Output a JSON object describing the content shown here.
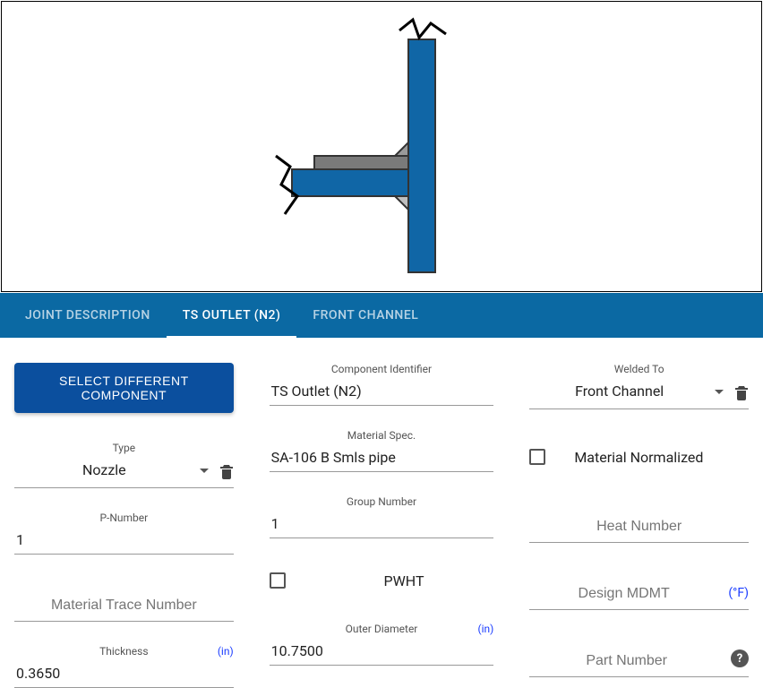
{
  "tabs": {
    "joint_description": "JOINT DESCRIPTION",
    "ts_outlet": "TS OUTLET (N2)",
    "front_channel": "FRONT CHANNEL"
  },
  "button": {
    "select_component": "SELECT DIFFERENT COMPONENT"
  },
  "fields": {
    "component_identifier": {
      "label": "Component Identifier",
      "value": "TS Outlet (N2)"
    },
    "welded_to": {
      "label": "Welded To",
      "value": "Front Channel"
    },
    "type": {
      "label": "Type",
      "value": "Nozzle"
    },
    "material_spec": {
      "label": "Material Spec.",
      "value": "SA-106 B Smls pipe"
    },
    "material_normalized": {
      "label": "Material Normalized"
    },
    "p_number": {
      "label": "P-Number",
      "value": "1"
    },
    "group_number": {
      "label": "Group Number",
      "value": "1"
    },
    "heat_number": {
      "placeholder": "Heat Number"
    },
    "material_trace_number": {
      "placeholder": "Material Trace Number"
    },
    "pwht": {
      "label": "PWHT"
    },
    "design_mdmt": {
      "placeholder": "Design MDMT",
      "unit": "(°F)"
    },
    "thickness": {
      "label": "Thickness",
      "unit": "(in)",
      "value": "0.3650"
    },
    "outer_diameter": {
      "label": "Outer Diameter",
      "unit": "(in)",
      "value": "10.7500"
    },
    "part_number": {
      "placeholder": "Part Number"
    }
  }
}
